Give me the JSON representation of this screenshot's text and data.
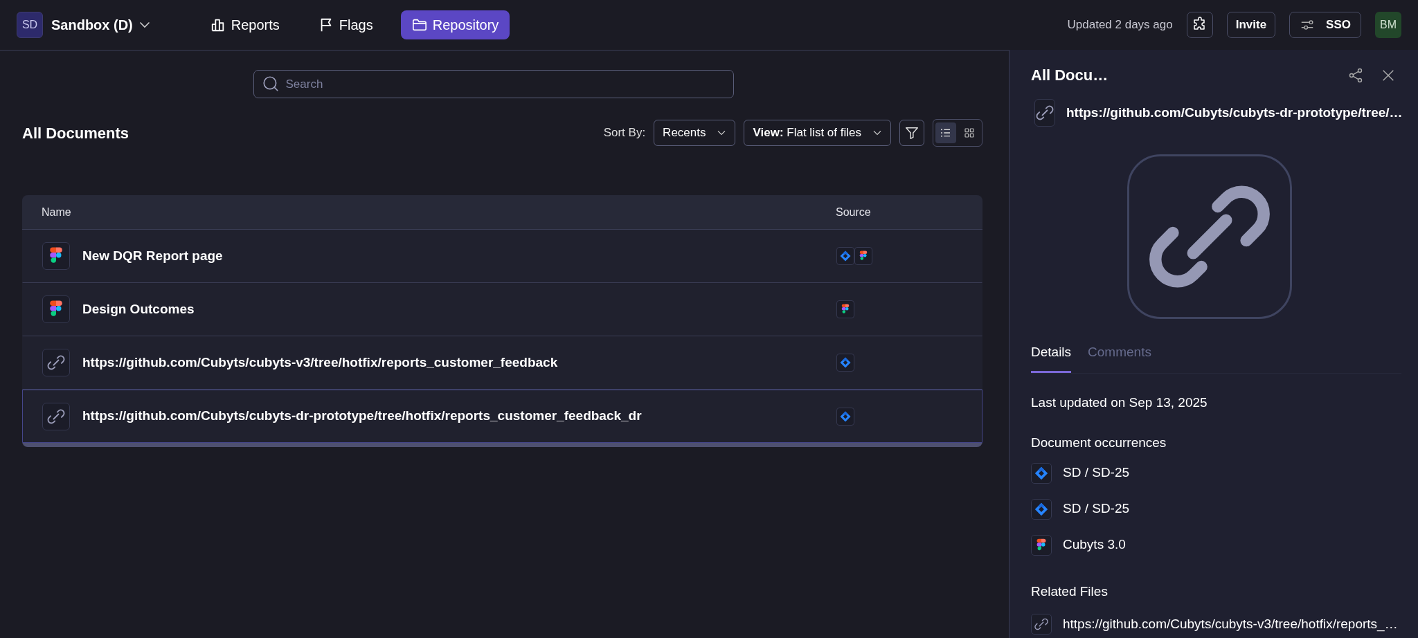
{
  "workspace": {
    "initials": "SD",
    "name": "Sandbox (D)"
  },
  "nav": [
    {
      "kind": "chart",
      "label": "Reports",
      "selected": false
    },
    {
      "kind": "flag",
      "label": "Flags",
      "selected": false
    },
    {
      "kind": "folder",
      "label": "Repository",
      "selected": true
    }
  ],
  "header_right": {
    "updated": "Updated 2 days ago",
    "invite": "Invite",
    "sso": "SSO",
    "avatar": "BM"
  },
  "search": {
    "placeholder": "Search"
  },
  "page_title": "All Documents",
  "sort": {
    "label": "Sort By:",
    "value": "Recents"
  },
  "view": {
    "label": "View:",
    "value": "Flat list of files"
  },
  "layout_toggle": [
    {
      "kind": "list",
      "selected": true
    },
    {
      "kind": "grid",
      "selected": false
    }
  ],
  "table": {
    "columns": [
      "Name",
      "Source"
    ],
    "rows": [
      {
        "kind": "figma",
        "name": "New DQR Report page",
        "sources": [
          {
            "kind": "jira"
          },
          {
            "kind": "figma"
          }
        ],
        "selected": false
      },
      {
        "kind": "figma",
        "name": "Design Outcomes",
        "sources": [
          {
            "kind": "figma"
          }
        ],
        "selected": false
      },
      {
        "kind": "link",
        "name": "https://github.com/Cubyts/cubyts-v3/tree/hotfix/reports_customer_feedback",
        "sources": [
          {
            "kind": "jira"
          }
        ],
        "selected": false
      },
      {
        "kind": "link",
        "name": "https://github.com/Cubyts/cubyts-dr-prototype/tree/hotfix/reports_customer_feedback_dr",
        "sources": [
          {
            "kind": "jira"
          }
        ],
        "selected": true
      }
    ]
  },
  "panel": {
    "title": "All Docu…",
    "file": {
      "kind": "link",
      "name": "https://github.com/Cubyts/cubyts-dr-prototype/tree/…"
    },
    "tabs": [
      {
        "label": "Details",
        "selected": true
      },
      {
        "label": "Comments",
        "selected": false
      }
    ],
    "last_updated": "Last updated on Sep 13, 2025",
    "occurrences_title": "Document occurrences",
    "occurrences": [
      {
        "kind": "jira",
        "label": "SD / SD-25"
      },
      {
        "kind": "jira",
        "label": "SD / SD-25"
      },
      {
        "kind": "figma",
        "label": "Cubyts 3.0"
      }
    ],
    "related_title": "Related Files",
    "related": [
      {
        "kind": "link",
        "label": "https://github.com/Cubyts/cubyts-v3/tree/hotfix/reports_…"
      }
    ]
  }
}
